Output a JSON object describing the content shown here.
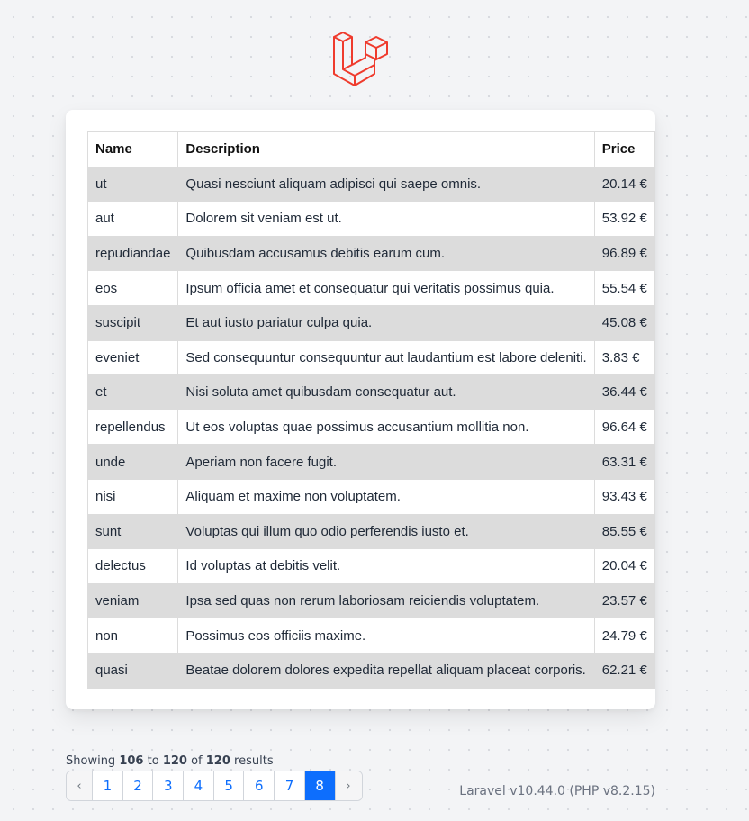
{
  "header": {
    "logo_icon": "laravel-logo-icon",
    "logo_color": "#ef3b2d"
  },
  "table": {
    "columns": [
      "Name",
      "Description",
      "Price"
    ],
    "rows": [
      {
        "name": "ut",
        "description": "Quasi nesciunt aliquam adipisci qui saepe omnis.",
        "price": "20.14 €"
      },
      {
        "name": "aut",
        "description": "Dolorem sit veniam est ut.",
        "price": "53.92 €"
      },
      {
        "name": "repudiandae",
        "description": "Quibusdam accusamus debitis earum cum.",
        "price": "96.89 €"
      },
      {
        "name": "eos",
        "description": "Ipsum officia amet et consequatur qui veritatis possimus quia.",
        "price": "55.54 €"
      },
      {
        "name": "suscipit",
        "description": "Et aut iusto pariatur culpa quia.",
        "price": "45.08 €"
      },
      {
        "name": "eveniet",
        "description": "Sed consequuntur consequuntur aut laudantium est labore deleniti.",
        "price": "3.83 €"
      },
      {
        "name": "et",
        "description": "Nisi soluta amet quibusdam consequatur aut.",
        "price": "36.44 €"
      },
      {
        "name": "repellendus",
        "description": "Ut eos voluptas quae possimus accusantium mollitia non.",
        "price": "96.64 €"
      },
      {
        "name": "unde",
        "description": "Aperiam non facere fugit.",
        "price": "63.31 €"
      },
      {
        "name": "nisi",
        "description": "Aliquam et maxime non voluptatem.",
        "price": "93.43 €"
      },
      {
        "name": "sunt",
        "description": "Voluptas qui illum quo odio perferendis iusto et.",
        "price": "85.55 €"
      },
      {
        "name": "delectus",
        "description": "Id voluptas at debitis velit.",
        "price": "20.04 €"
      },
      {
        "name": "veniam",
        "description": "Ipsa sed quas non rerum laboriosam reiciendis voluptatem.",
        "price": "23.57 €"
      },
      {
        "name": "non",
        "description": "Possimus eos officiis maxime.",
        "price": "24.79 €"
      },
      {
        "name": "quasi",
        "description": "Beatae dolorem dolores expedita repellat aliquam placeat corporis.",
        "price": "62.21 €"
      }
    ]
  },
  "pagination": {
    "showing_prefix": "Showing",
    "from": "106",
    "to_word": "to",
    "to": "120",
    "of_word": "of",
    "total": "120",
    "results_word": "results",
    "prev_label": "‹",
    "next_label": "›",
    "pages": [
      "1",
      "2",
      "3",
      "4",
      "5",
      "6",
      "7",
      "8"
    ],
    "current_page": "8",
    "active_color": "#0d6efd"
  },
  "footer": {
    "version": "Laravel v10.44.0 (PHP v8.2.15)"
  }
}
